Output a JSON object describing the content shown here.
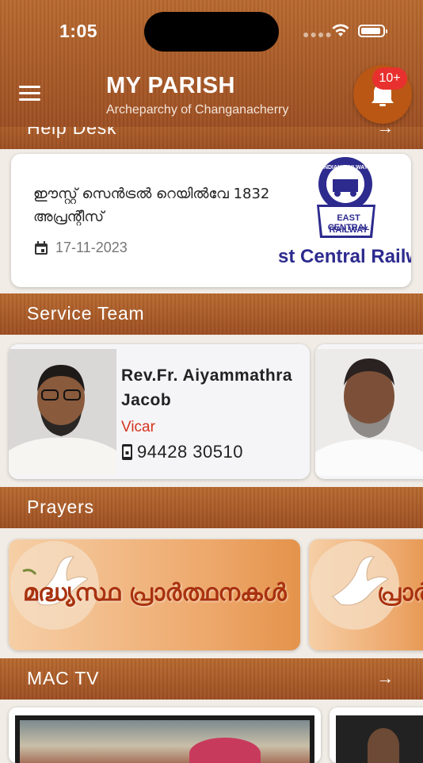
{
  "status_bar": {
    "time": "1:05"
  },
  "header": {
    "title": "MY PARISH",
    "subtitle": "Archeparchy of Changanacherry",
    "notification_count": "10+"
  },
  "help_desk": {
    "label": "Help Desk"
  },
  "news": {
    "text": "ഈസ്റ്റ് സെൻട്രൽ റെയിൽവേ 1832 അപ്രന്റീസ്",
    "date": "17-11-2023",
    "logo_top": "INDIAN RAILWAYS",
    "logo_mid": "EAST CENTRAL",
    "logo_bottom": "RAILWAY",
    "banner_text": "st Central Railw"
  },
  "service_team": {
    "label": "Service Team",
    "members": [
      {
        "name": "Rev.Fr. Aiyammathra Jacob",
        "role": "Vicar",
        "phone": "94428 30510"
      }
    ]
  },
  "prayers": {
    "label": "Prayers",
    "items": [
      {
        "title": "മദ്ധ്യസ്ഥ പ്രാർത്ഥനകൾ"
      },
      {
        "title": "പ്രാർ"
      }
    ]
  },
  "mac_tv": {
    "label": "MAC TV"
  },
  "colors": {
    "wood": "#a9592a",
    "accent_red": "#d5321e",
    "badge_red": "#e8312e",
    "bell_orange": "#ba5714"
  }
}
